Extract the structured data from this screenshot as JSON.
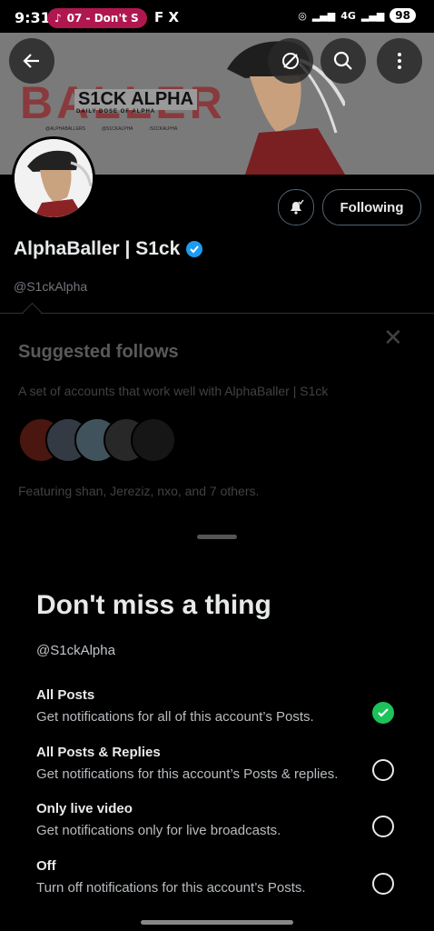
{
  "status_bar": {
    "time": "9:31",
    "media_title": "07 - Don't S",
    "app_icons": "F X",
    "network": "4G",
    "battery": "98"
  },
  "banner": {
    "word": "BALLER",
    "brand": "S1CK ALPHA",
    "tagline": "DAILY DOSE OF ALPHA",
    "handle_1": "@ALPHABALLERS",
    "handle_2": "@S1CKALPHA",
    "handle_3": "/S1CKALPHA"
  },
  "profile": {
    "name": "AlphaBaller | S1ck",
    "handle": "@S1ckAlpha",
    "following_label": "Following",
    "verified_color": "#1d9bf0"
  },
  "suggested": {
    "title": "Suggested follows",
    "description": "A set of accounts that work well with AlphaBaller | S1ck",
    "featuring": "Featuring shan, Jereziz, nxo, and 7 others."
  },
  "sheet": {
    "title": "Don't miss a thing",
    "handle": "@S1ckAlpha",
    "options": [
      {
        "title": "All Posts",
        "desc": "Get notifications for all of this account’s Posts.",
        "selected": true
      },
      {
        "title": "All Posts & Replies",
        "desc": "Get notifications for this account’s Posts & replies.",
        "selected": false
      },
      {
        "title": "Only live video",
        "desc": "Get notifications only for live broadcasts.",
        "selected": false
      },
      {
        "title": "Off",
        "desc": "Turn off notifications for this account’s Posts.",
        "selected": false
      }
    ]
  },
  "colors": {
    "accent_green": "#1ec15b",
    "media_chip": "#b0174f"
  }
}
